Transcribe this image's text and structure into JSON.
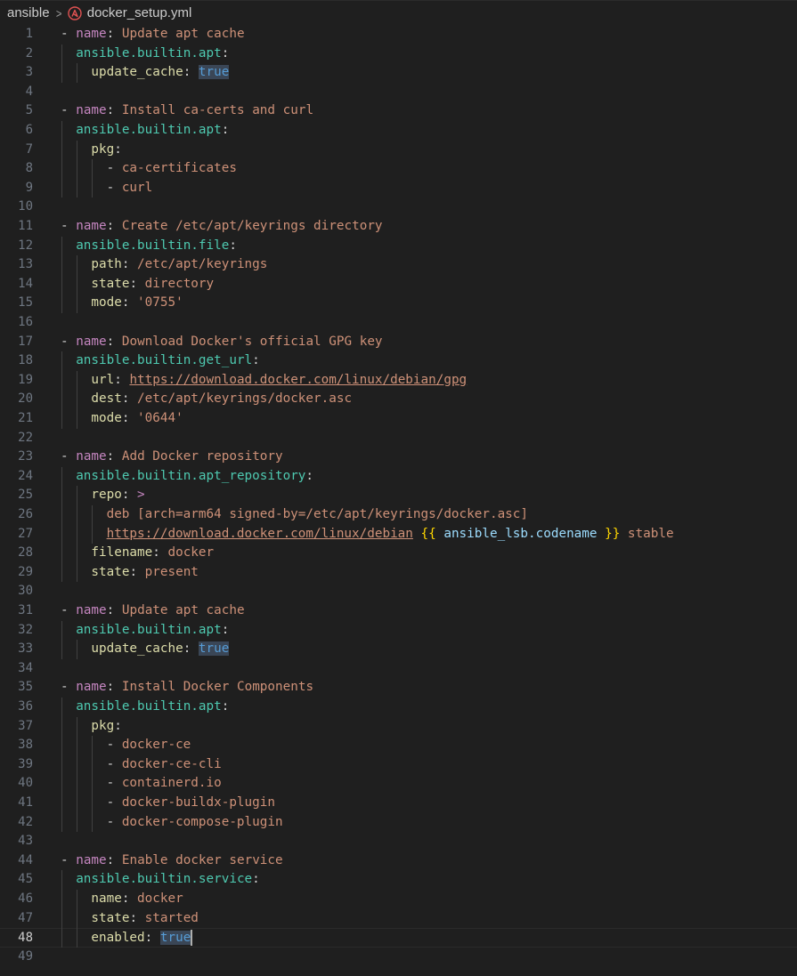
{
  "breadcrumb": {
    "folder": "ansible",
    "file": "docker_setup.yml",
    "file_icon": "ansible-icon",
    "separator_icon": "chevron-right-icon"
  },
  "colors": {
    "background": "#1f1f1f",
    "keyword": "#c586c0",
    "string": "#ce9178",
    "module": "#4ec9b0",
    "property": "#dcdcaa",
    "boolean": "#569cd6",
    "variable": "#9cdcfe",
    "file_icon": "#e05252"
  },
  "editor": {
    "current_line": 48,
    "lines": [
      {
        "n": "1",
        "indent": 0,
        "tokens": [
          [
            "dash",
            "- "
          ],
          [
            "key",
            "name"
          ],
          [
            "punct",
            ": "
          ],
          [
            "str",
            "Update apt cache"
          ]
        ]
      },
      {
        "n": "2",
        "indent": 1,
        "tokens": [
          [
            "mod",
            "ansible.builtin.apt"
          ],
          [
            "punct",
            ":"
          ]
        ]
      },
      {
        "n": "3",
        "indent": 2,
        "tokens": [
          [
            "prop",
            "update_cache"
          ],
          [
            "punct",
            ": "
          ],
          [
            "bool",
            "true"
          ]
        ]
      },
      {
        "n": "4",
        "indent": 0,
        "tokens": []
      },
      {
        "n": "5",
        "indent": 0,
        "tokens": [
          [
            "dash",
            "- "
          ],
          [
            "key",
            "name"
          ],
          [
            "punct",
            ": "
          ],
          [
            "str",
            "Install ca-certs and curl"
          ]
        ]
      },
      {
        "n": "6",
        "indent": 1,
        "tokens": [
          [
            "mod",
            "ansible.builtin.apt"
          ],
          [
            "punct",
            ":"
          ]
        ]
      },
      {
        "n": "7",
        "indent": 2,
        "tokens": [
          [
            "prop",
            "pkg"
          ],
          [
            "punct",
            ":"
          ]
        ]
      },
      {
        "n": "8",
        "indent": 3,
        "tokens": [
          [
            "dash",
            "- "
          ],
          [
            "str",
            "ca-certificates"
          ]
        ]
      },
      {
        "n": "9",
        "indent": 3,
        "tokens": [
          [
            "dash",
            "- "
          ],
          [
            "str",
            "curl"
          ]
        ]
      },
      {
        "n": "10",
        "indent": 0,
        "tokens": []
      },
      {
        "n": "11",
        "indent": 0,
        "tokens": [
          [
            "dash",
            "- "
          ],
          [
            "key",
            "name"
          ],
          [
            "punct",
            ": "
          ],
          [
            "str",
            "Create /etc/apt/keyrings directory"
          ]
        ]
      },
      {
        "n": "12",
        "indent": 1,
        "tokens": [
          [
            "mod",
            "ansible.builtin.file"
          ],
          [
            "punct",
            ":"
          ]
        ]
      },
      {
        "n": "13",
        "indent": 2,
        "tokens": [
          [
            "prop",
            "path"
          ],
          [
            "punct",
            ": "
          ],
          [
            "str",
            "/etc/apt/keyrings"
          ]
        ]
      },
      {
        "n": "14",
        "indent": 2,
        "tokens": [
          [
            "prop",
            "state"
          ],
          [
            "punct",
            ": "
          ],
          [
            "str",
            "directory"
          ]
        ]
      },
      {
        "n": "15",
        "indent": 2,
        "tokens": [
          [
            "prop",
            "mode"
          ],
          [
            "punct",
            ": "
          ],
          [
            "str",
            "'0755'"
          ]
        ]
      },
      {
        "n": "16",
        "indent": 0,
        "tokens": []
      },
      {
        "n": "17",
        "indent": 0,
        "tokens": [
          [
            "dash",
            "- "
          ],
          [
            "key",
            "name"
          ],
          [
            "punct",
            ": "
          ],
          [
            "str",
            "Download Docker's official GPG key"
          ]
        ]
      },
      {
        "n": "18",
        "indent": 1,
        "tokens": [
          [
            "mod",
            "ansible.builtin.get_url"
          ],
          [
            "punct",
            ":"
          ]
        ]
      },
      {
        "n": "19",
        "indent": 2,
        "tokens": [
          [
            "prop",
            "url"
          ],
          [
            "punct",
            ": "
          ],
          [
            "url",
            "https://download.docker.com/linux/debian/gpg"
          ]
        ]
      },
      {
        "n": "20",
        "indent": 2,
        "tokens": [
          [
            "prop",
            "dest"
          ],
          [
            "punct",
            ": "
          ],
          [
            "str",
            "/etc/apt/keyrings/docker.asc"
          ]
        ]
      },
      {
        "n": "21",
        "indent": 2,
        "tokens": [
          [
            "prop",
            "mode"
          ],
          [
            "punct",
            ": "
          ],
          [
            "str",
            "'0644'"
          ]
        ]
      },
      {
        "n": "22",
        "indent": 0,
        "tokens": []
      },
      {
        "n": "23",
        "indent": 0,
        "tokens": [
          [
            "dash",
            "- "
          ],
          [
            "key",
            "name"
          ],
          [
            "punct",
            ": "
          ],
          [
            "str",
            "Add Docker repository"
          ]
        ]
      },
      {
        "n": "24",
        "indent": 1,
        "tokens": [
          [
            "mod",
            "ansible.builtin.apt_repository"
          ],
          [
            "punct",
            ":"
          ]
        ]
      },
      {
        "n": "25",
        "indent": 2,
        "tokens": [
          [
            "prop",
            "repo"
          ],
          [
            "punct",
            ": "
          ],
          [
            "op",
            ">"
          ]
        ]
      },
      {
        "n": "26",
        "indent": 3,
        "tokens": [
          [
            "str",
            "deb [arch=arm64 signed-by=/etc/apt/keyrings/docker.asc]"
          ]
        ]
      },
      {
        "n": "27",
        "indent": 3,
        "tokens": [
          [
            "url",
            "https://download.docker.com/linux/debian"
          ],
          [
            "str",
            " "
          ],
          [
            "brace",
            "{{"
          ],
          [
            "str",
            " "
          ],
          [
            "var",
            "ansible_lsb.codename"
          ],
          [
            "str",
            " "
          ],
          [
            "brace",
            "}}"
          ],
          [
            "str",
            " stable"
          ]
        ]
      },
      {
        "n": "28",
        "indent": 2,
        "tokens": [
          [
            "prop",
            "filename"
          ],
          [
            "punct",
            ": "
          ],
          [
            "str",
            "docker"
          ]
        ]
      },
      {
        "n": "29",
        "indent": 2,
        "tokens": [
          [
            "prop",
            "state"
          ],
          [
            "punct",
            ": "
          ],
          [
            "str",
            "present"
          ]
        ]
      },
      {
        "n": "30",
        "indent": 0,
        "tokens": []
      },
      {
        "n": "31",
        "indent": 0,
        "tokens": [
          [
            "dash",
            "- "
          ],
          [
            "key",
            "name"
          ],
          [
            "punct",
            ": "
          ],
          [
            "str",
            "Update apt cache"
          ]
        ]
      },
      {
        "n": "32",
        "indent": 1,
        "tokens": [
          [
            "mod",
            "ansible.builtin.apt"
          ],
          [
            "punct",
            ":"
          ]
        ]
      },
      {
        "n": "33",
        "indent": 2,
        "tokens": [
          [
            "prop",
            "update_cache"
          ],
          [
            "punct",
            ": "
          ],
          [
            "bool",
            "true"
          ]
        ]
      },
      {
        "n": "34",
        "indent": 0,
        "tokens": []
      },
      {
        "n": "35",
        "indent": 0,
        "tokens": [
          [
            "dash",
            "- "
          ],
          [
            "key",
            "name"
          ],
          [
            "punct",
            ": "
          ],
          [
            "str",
            "Install Docker Components"
          ]
        ]
      },
      {
        "n": "36",
        "indent": 1,
        "tokens": [
          [
            "mod",
            "ansible.builtin.apt"
          ],
          [
            "punct",
            ":"
          ]
        ]
      },
      {
        "n": "37",
        "indent": 2,
        "tokens": [
          [
            "prop",
            "pkg"
          ],
          [
            "punct",
            ":"
          ]
        ]
      },
      {
        "n": "38",
        "indent": 3,
        "tokens": [
          [
            "dash",
            "- "
          ],
          [
            "str",
            "docker-ce"
          ]
        ]
      },
      {
        "n": "39",
        "indent": 3,
        "tokens": [
          [
            "dash",
            "- "
          ],
          [
            "str",
            "docker-ce-cli"
          ]
        ]
      },
      {
        "n": "40",
        "indent": 3,
        "tokens": [
          [
            "dash",
            "- "
          ],
          [
            "str",
            "containerd.io"
          ]
        ]
      },
      {
        "n": "41",
        "indent": 3,
        "tokens": [
          [
            "dash",
            "- "
          ],
          [
            "str",
            "docker-buildx-plugin"
          ]
        ]
      },
      {
        "n": "42",
        "indent": 3,
        "tokens": [
          [
            "dash",
            "- "
          ],
          [
            "str",
            "docker-compose-plugin"
          ]
        ]
      },
      {
        "n": "43",
        "indent": 0,
        "tokens": []
      },
      {
        "n": "44",
        "indent": 0,
        "tokens": [
          [
            "dash",
            "- "
          ],
          [
            "key",
            "name"
          ],
          [
            "punct",
            ": "
          ],
          [
            "str",
            "Enable docker service"
          ]
        ]
      },
      {
        "n": "45",
        "indent": 1,
        "tokens": [
          [
            "mod",
            "ansible.builtin.service"
          ],
          [
            "punct",
            ":"
          ]
        ]
      },
      {
        "n": "46",
        "indent": 2,
        "tokens": [
          [
            "prop",
            "name"
          ],
          [
            "punct",
            ": "
          ],
          [
            "str",
            "docker"
          ]
        ]
      },
      {
        "n": "47",
        "indent": 2,
        "tokens": [
          [
            "prop",
            "state"
          ],
          [
            "punct",
            ": "
          ],
          [
            "str",
            "started"
          ]
        ]
      },
      {
        "n": "48",
        "indent": 2,
        "tokens": [
          [
            "prop",
            "enabled"
          ],
          [
            "punct",
            ": "
          ],
          [
            "bool",
            "true"
          ]
        ]
      },
      {
        "n": "49",
        "indent": 0,
        "tokens": []
      }
    ]
  }
}
